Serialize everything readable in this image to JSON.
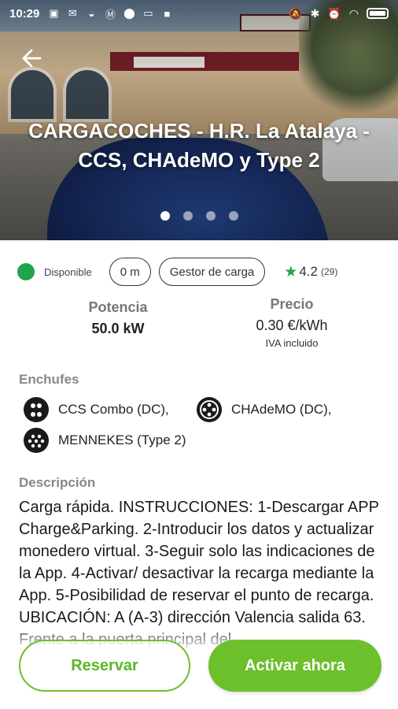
{
  "status_bar": {
    "time": "10:29",
    "notification_icons": [
      "photo-icon",
      "mail-icon",
      "bowl-icon",
      "m-icon",
      "location-icon",
      "battery-saver-icon",
      "square-icon"
    ],
    "system_icons": [
      "mute-icon",
      "bluetooth-icon",
      "alarm-icon",
      "wifi-icon",
      "battery-icon"
    ]
  },
  "header": {
    "title": "CARGACOCHES - H.R. La Atalaya - CCS, CHAdeMO y Type 2",
    "carousel_dots": 4,
    "carousel_active_index": 0
  },
  "info": {
    "status": "Disponible",
    "status_color": "#1ea54b",
    "distance": "0 m",
    "operator": "Gestor de carga",
    "rating": "4.2",
    "rating_count": "(29)"
  },
  "specs": {
    "power_label": "Potencia",
    "power_value": "50.0 kW",
    "price_label": "Precio",
    "price_value": "0.30 €/kWh",
    "price_note": "IVA incluido"
  },
  "plugs": {
    "title": "Enchufes",
    "items": [
      {
        "label": "CCS Combo (DC),",
        "icon": "ccs-combo-plug-icon"
      },
      {
        "label": "CHAdeMO (DC),",
        "icon": "chademo-plug-icon"
      },
      {
        "label": "MENNEKES (Type 2)",
        "icon": "mennekes-plug-icon"
      }
    ]
  },
  "description": {
    "title": "Descripción",
    "text": "Carga rápida. INSTRUCCIONES: 1-Descargar APP Charge&Parking. 2-Introducir los datos y actualizar monedero virtual. 3-Seguir solo las indicaciones de la App. 4-Activar/ desactivar la recarga mediante la App. 5-Posibilidad de reservar el punto de recarga. UBICACIÓN: A (A-3) dirección Valencia salida 63. Frente a la puerta principal del"
  },
  "actions": {
    "reserve_label": "Reservar",
    "activate_label": "Activar ahora",
    "accent_color": "#6cc02b"
  }
}
